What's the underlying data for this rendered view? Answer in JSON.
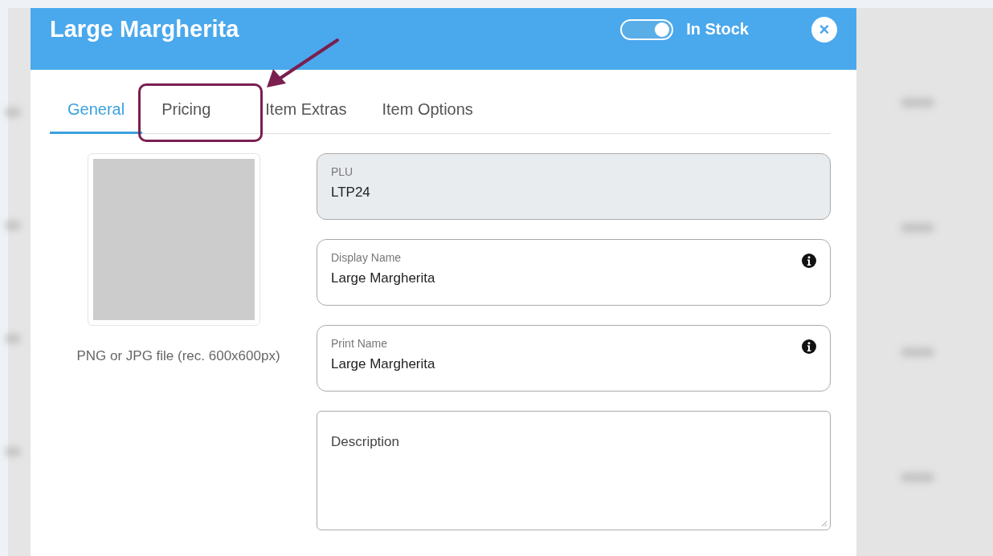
{
  "dialog": {
    "title": "Large Margherita",
    "stock_toggle": {
      "label": "In Stock",
      "on": true
    },
    "close": "×"
  },
  "tabs": [
    {
      "label": "General",
      "selected": true
    },
    {
      "label": "Pricing",
      "selected": false
    },
    {
      "label": "Item Extras",
      "selected": false
    },
    {
      "label": "Item Options",
      "selected": false
    }
  ],
  "image": {
    "hint": "PNG or JPG file (rec. 600x600px)"
  },
  "fields": [
    {
      "kind": "input",
      "label": "PLU",
      "value": "LTP24",
      "disabled": true,
      "info": false
    },
    {
      "kind": "input",
      "label": "Display Name",
      "value": "Large Margherita",
      "disabled": false,
      "info": true
    },
    {
      "kind": "input",
      "label": "Print Name",
      "value": "Large Margherita",
      "disabled": false,
      "info": true
    },
    {
      "kind": "textarea",
      "placeholder": "Description",
      "disabled": false
    }
  ]
}
